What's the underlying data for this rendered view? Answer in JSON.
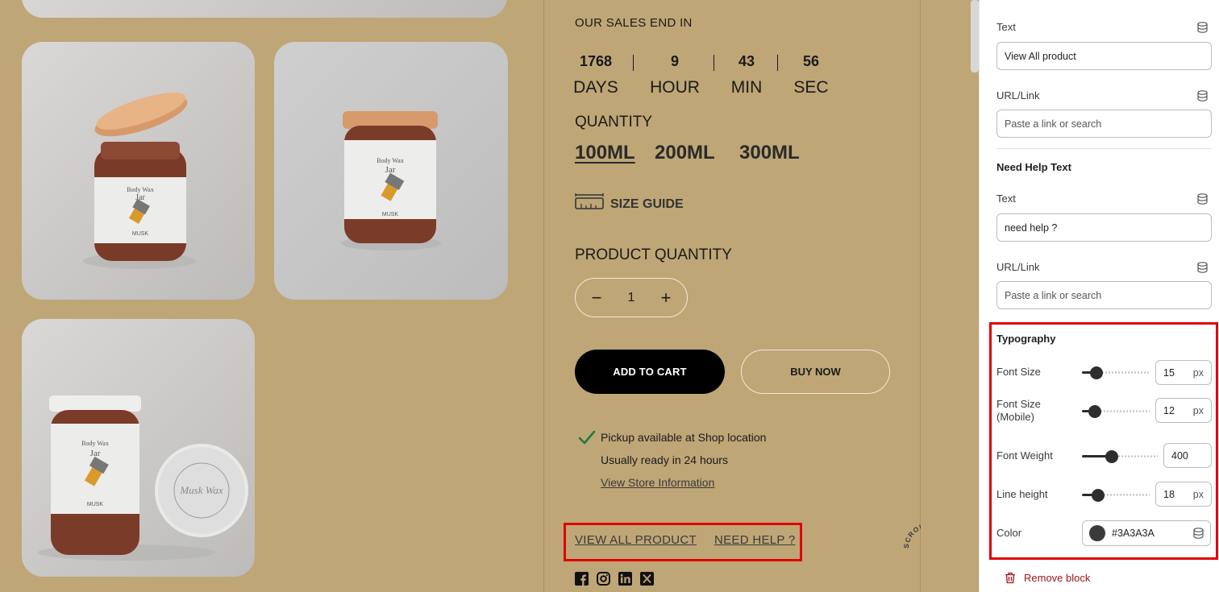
{
  "sales": {
    "title": "OUR SALES END IN",
    "countdown": [
      {
        "value": "1768",
        "label": "DAYS"
      },
      {
        "value": "9",
        "label": "HOUR"
      },
      {
        "value": "43",
        "label": "MIN"
      },
      {
        "value": "56",
        "label": "SEC"
      }
    ]
  },
  "quantity": {
    "title": "QUANTITY",
    "variants": [
      "100ML",
      "200ML",
      "300ML"
    ],
    "selected": "100ML"
  },
  "size_guide": "SIZE GUIDE",
  "product_quantity": {
    "title": "PRODUCT QUANTITY",
    "value": "1",
    "minus": "−",
    "plus": "+"
  },
  "buttons": {
    "add_to_cart": "ADD TO CART",
    "buy_now": "BUY NOW"
  },
  "pickup": {
    "available": "Pickup available at Shop location",
    "ready": "Usually ready in 24 hours",
    "store_link": "View Store Information"
  },
  "footer_links": {
    "view_all": "VIEW ALL PRODUCT",
    "need_help": "NEED HELP ?"
  },
  "socials": [
    "facebook-icon",
    "instagram-icon",
    "linkedin-icon",
    "x-icon"
  ],
  "scroll_top": "SCROLL TO TOP ·",
  "panel": {
    "text_label": "Text",
    "text_value": "View All product",
    "url_label": "URL/Link",
    "url_placeholder": "Paste a link or search",
    "need_help_title": "Need Help Text",
    "help_text_label": "Text",
    "help_text_value": "need help ?",
    "help_url_label": "URL/Link",
    "help_url_placeholder": "Paste a link or search",
    "typography": {
      "title": "Typography",
      "font_size_label": "Font Size",
      "font_size": "15",
      "font_size_mobile_label_1": "Font Size",
      "font_size_mobile_label_2": "(Mobile)",
      "font_size_mobile": "12",
      "font_weight_label": "Font Weight",
      "font_weight": "400",
      "line_height_label": "Line height",
      "line_height": "18",
      "unit": "px",
      "color_label": "Color",
      "color_value": "#3A3A3A"
    },
    "remove_block": "Remove block"
  },
  "colors": {
    "background": "#BFA677",
    "accent_red": "#E00000",
    "text_color": "#3A3A3A",
    "button_black": "#000000"
  }
}
